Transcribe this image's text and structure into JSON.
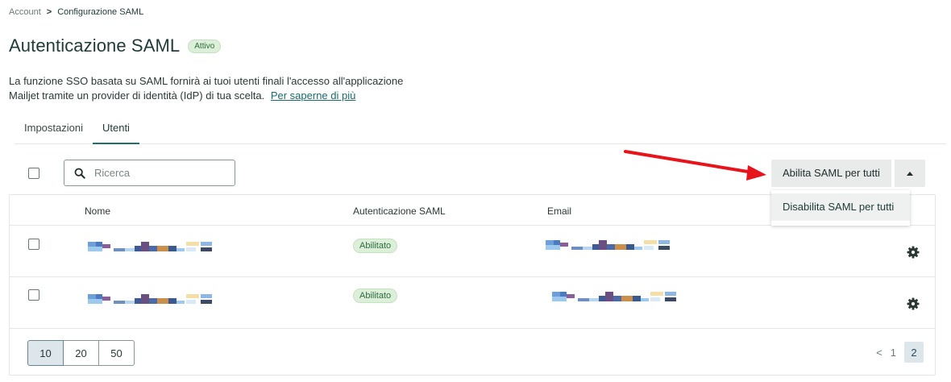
{
  "breadcrumb": {
    "root": "Account",
    "separator": ">",
    "current": "Configurazione SAML"
  },
  "page": {
    "title": "Autenticazione SAML",
    "status": "Attivo",
    "description_line1": "La funzione SSO basata su SAML fornirà ai tuoi utenti finali l'accesso all'applicazione",
    "description_line2": "Mailjet tramite un provider di identità (IdP) di tua scelta.",
    "learn_more": "Per saperne di più"
  },
  "tabs": [
    {
      "label": "Impostazioni",
      "active": false
    },
    {
      "label": "Utenti",
      "active": true
    }
  ],
  "toolbar": {
    "search_placeholder": "Ricerca",
    "search_value": "",
    "enable_all_label": "Abilita SAML per tutti",
    "dropdown_item": "Disabilita SAML per tutti"
  },
  "table": {
    "columns": [
      "Nome",
      "Autenticazione SAML",
      "Email"
    ],
    "rows": [
      {
        "saml_status": "Abilitato",
        "name_redacted": true,
        "email_redacted": true
      },
      {
        "saml_status": "Abilitato",
        "name_redacted": true,
        "email_redacted": true
      }
    ]
  },
  "pagination": {
    "page_sizes": [
      "10",
      "20",
      "50"
    ],
    "selected_page_size": "10",
    "prev_symbol": "<",
    "pages": [
      "1",
      "2"
    ],
    "current_page": "2"
  },
  "colors": {
    "accent": "#1f6f6d",
    "badge_bg": "#dcefd8",
    "badge_text": "#2f6b3f",
    "annotation_arrow": "#e8141b"
  },
  "icons": {
    "search": "search-icon",
    "caret": "caret-up-icon",
    "settings": "gear-icon"
  }
}
